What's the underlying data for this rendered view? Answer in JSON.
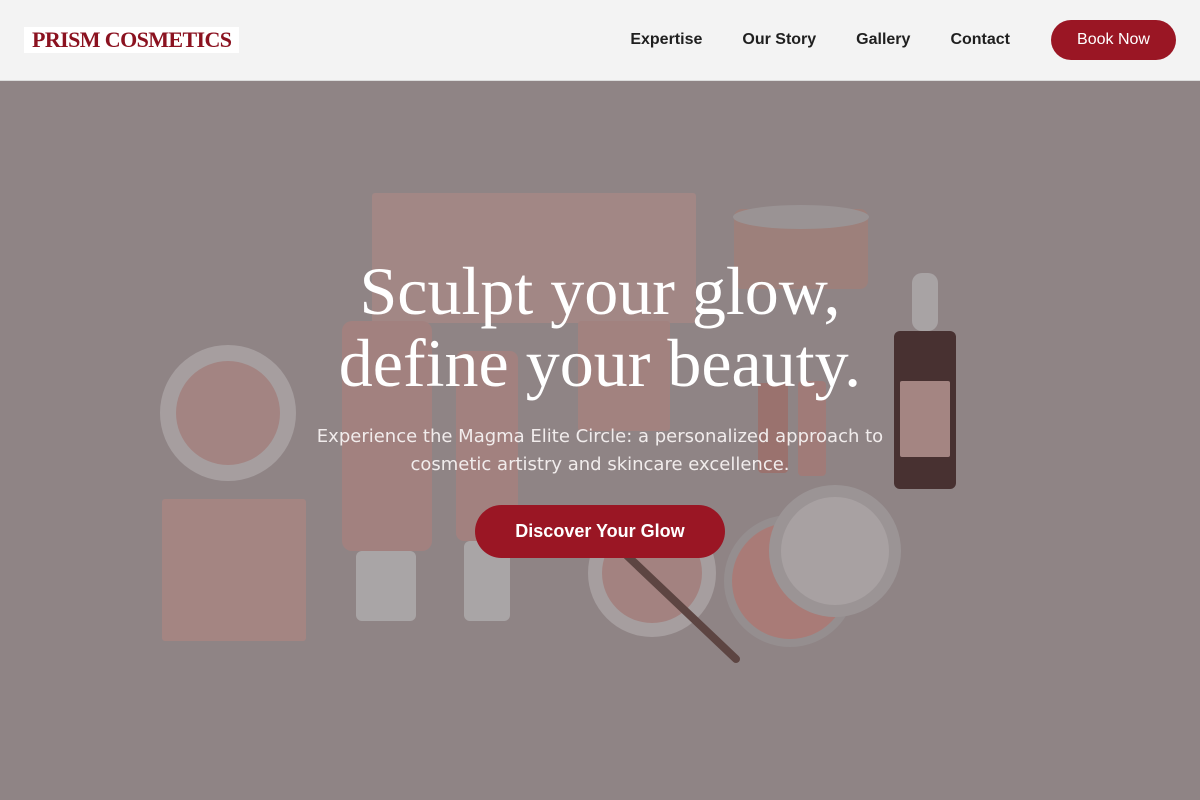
{
  "brand": {
    "name": "PRISM COSMETICS",
    "color": "#8b1220"
  },
  "nav": {
    "items": [
      {
        "label": "Expertise"
      },
      {
        "label": "Our Story"
      },
      {
        "label": "Gallery"
      },
      {
        "label": "Contact"
      }
    ],
    "cta_label": "Book Now"
  },
  "hero": {
    "headline_line1": "Sculpt your glow,",
    "headline_line2": "define your beauty.",
    "subtext": "Experience the Magma Elite Circle: a personalized approach to cosmetic artistry and skincare excellence.",
    "cta_label": "Discover Your Glow",
    "photo_label": "cosmetic products flat-lay"
  },
  "colors": {
    "accent": "#9a1624",
    "header_bg": "#f3f3f3",
    "nav_text": "#1f1f1f"
  }
}
